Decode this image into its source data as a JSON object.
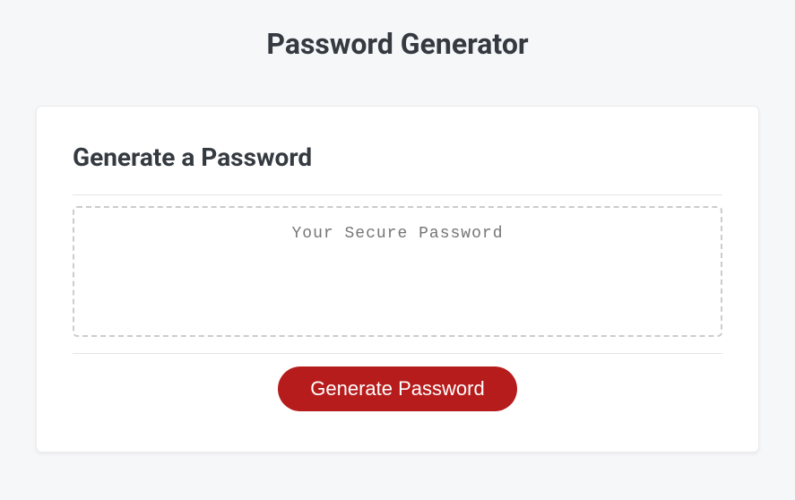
{
  "header": {
    "page_title": "Password Generator"
  },
  "card": {
    "section_title": "Generate a Password",
    "password_placeholder": "Your Secure Password",
    "password_value": "",
    "generate_button_label": "Generate Password"
  }
}
